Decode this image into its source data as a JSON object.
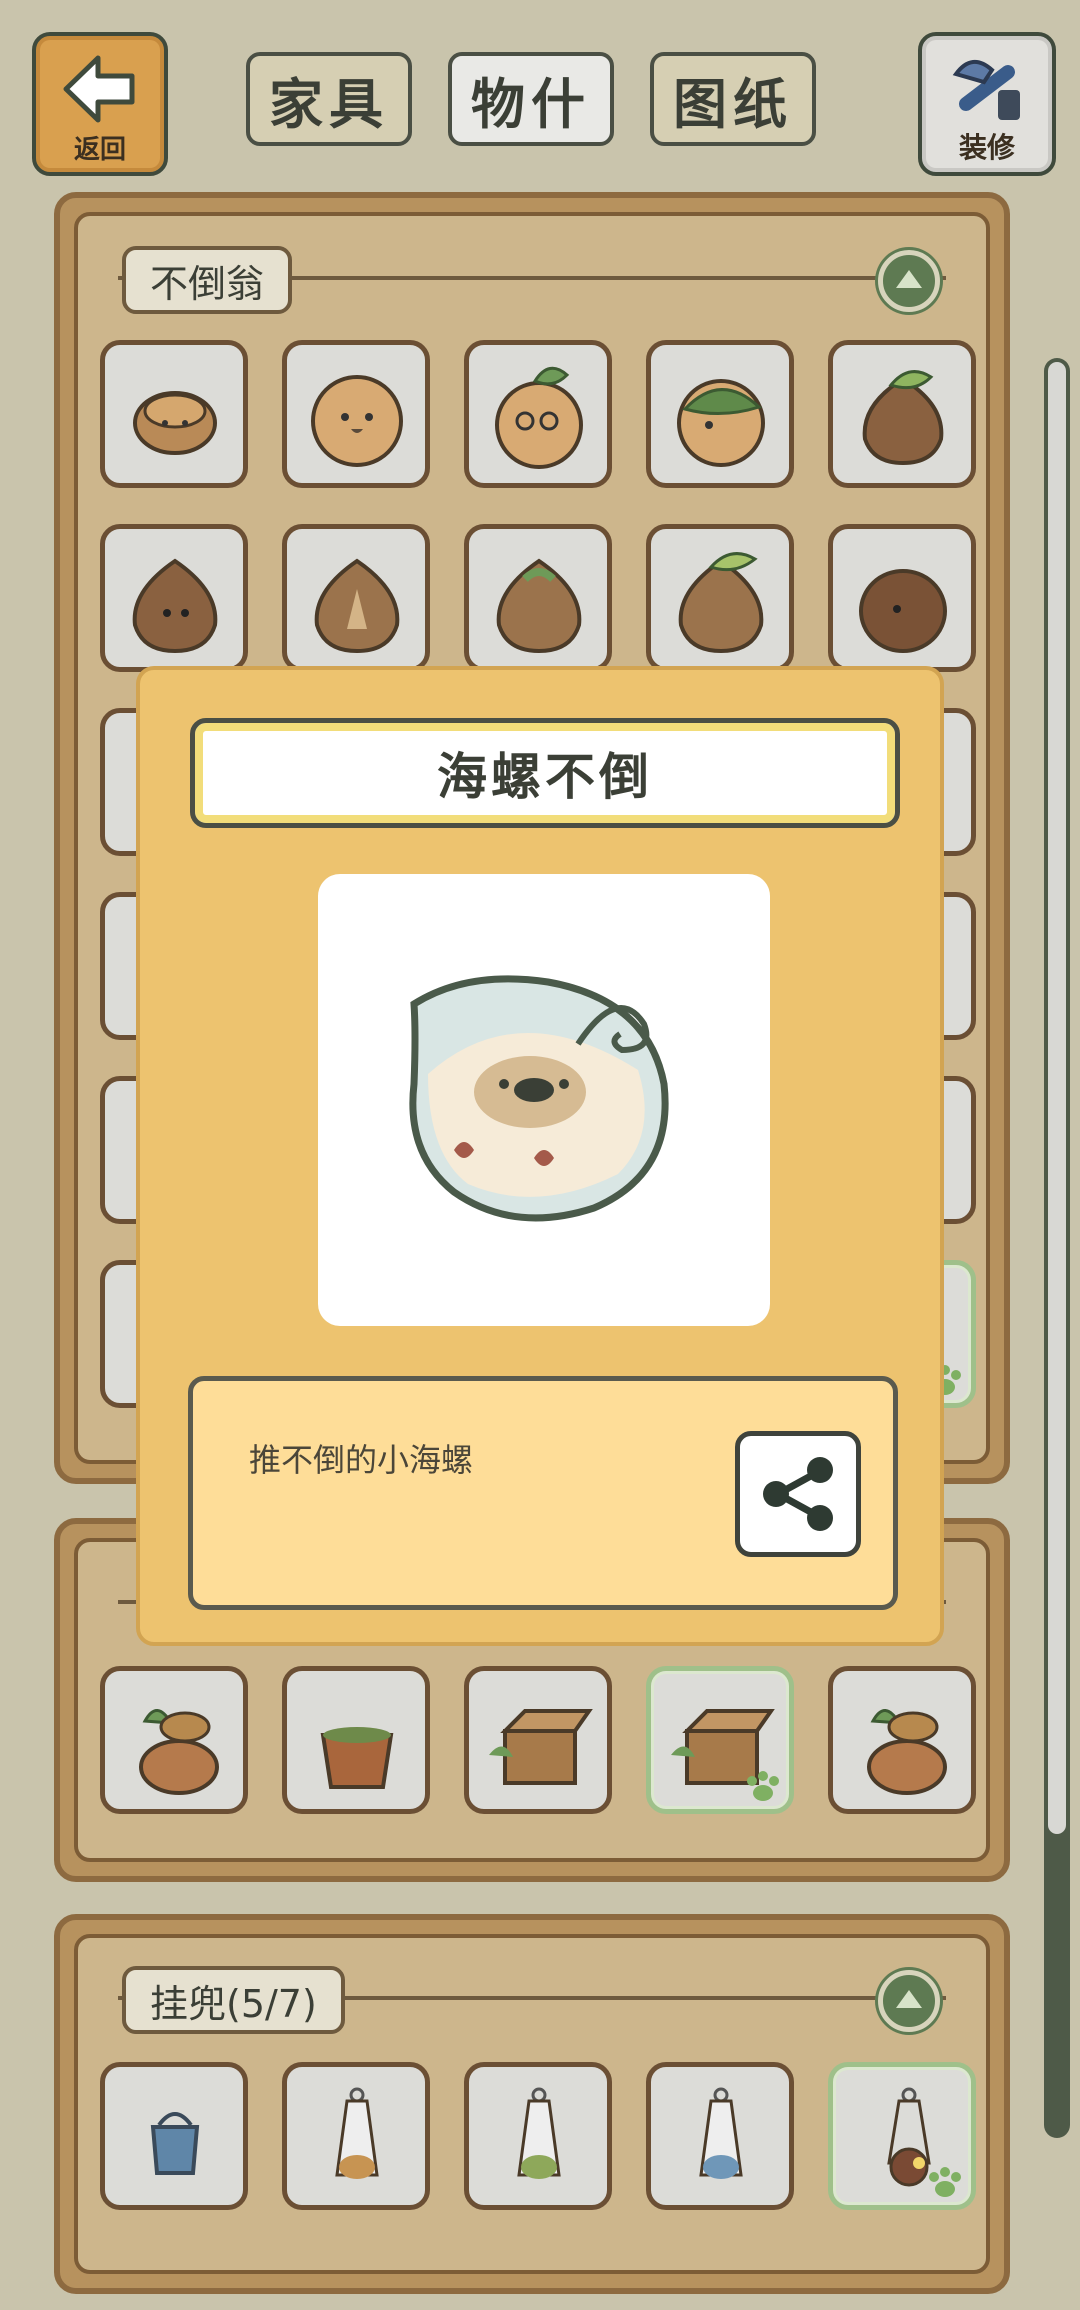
{
  "header": {
    "back_label": "返回",
    "tabs": [
      {
        "label": "家具",
        "active": false
      },
      {
        "label": "物什",
        "active": true
      },
      {
        "label": "图纸",
        "active": false
      }
    ],
    "decorate_label": "装修"
  },
  "sections": [
    {
      "label": "不倒翁",
      "collapse_icon": "chevron-up-icon"
    },
    {
      "label": "",
      "collapse_icon": ""
    },
    {
      "label": "挂兜(5/7)",
      "collapse_icon": "chevron-up-icon"
    }
  ],
  "detail": {
    "title": "海螺不倒",
    "description": "推不倒的小海螺",
    "share_icon": "share-icon"
  },
  "colors": {
    "background": "#c9c4ac",
    "panel": "#cdb68c",
    "detail_panel": "#edc36f",
    "selected_border": "#9fc08a"
  }
}
